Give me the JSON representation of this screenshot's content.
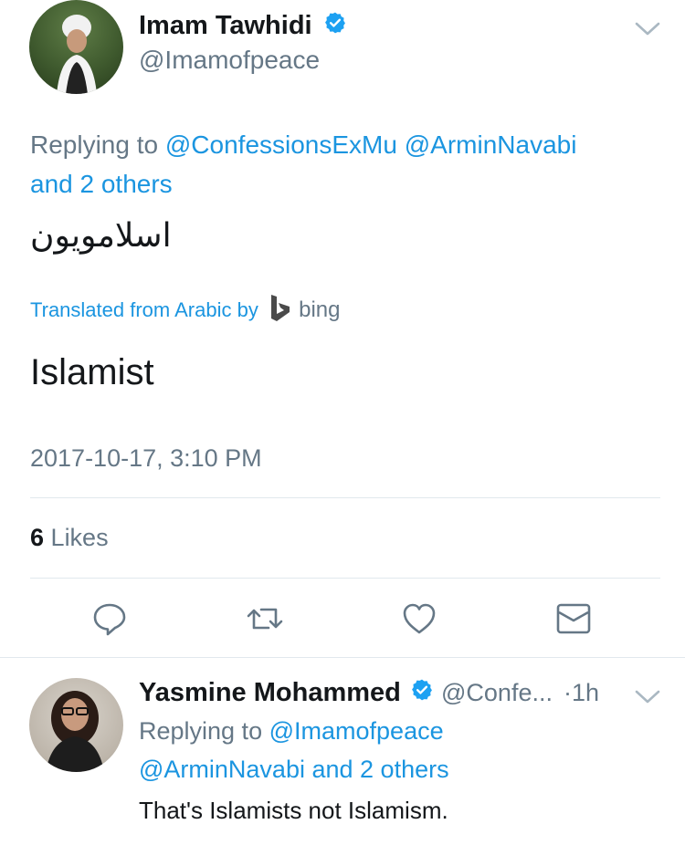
{
  "tweet": {
    "author_name": "Imam Tawhidi",
    "author_handle": "@Imamofpeace",
    "replying_prefix": "Replying to",
    "reply_mention_1": "@ConfessionsExMu",
    "reply_mention_2": "@ArminNavabi",
    "reply_others": "and 2 others",
    "text_arabic": "اسلامويون",
    "translated_label": "Translated from Arabic by",
    "translator_name": "bing",
    "translation_text": "Islamist",
    "timestamp": "2017-10-17, 3:10 PM",
    "likes_count": "6",
    "likes_label": "Likes",
    "verified": true
  },
  "actions": [
    "reply-icon",
    "retweet-icon",
    "like-icon",
    "share-icon"
  ],
  "reply": {
    "author_name": "Yasmine Mohammed",
    "author_handle": "@Confe...",
    "separator": "·",
    "time_ago": "1h",
    "replying_prefix": "Replying to",
    "reply_mention_1": "@Imamofpeace",
    "reply_mention_2": "@ArminNavabi",
    "reply_others": "and 2 others",
    "text": "That's Islamists not Islamism.",
    "verified": true
  },
  "colors": {
    "link": "#1b95e0",
    "muted": "#657786",
    "text": "#14171a",
    "divider": "#e1e8ed",
    "verified": "#1da1f2"
  }
}
